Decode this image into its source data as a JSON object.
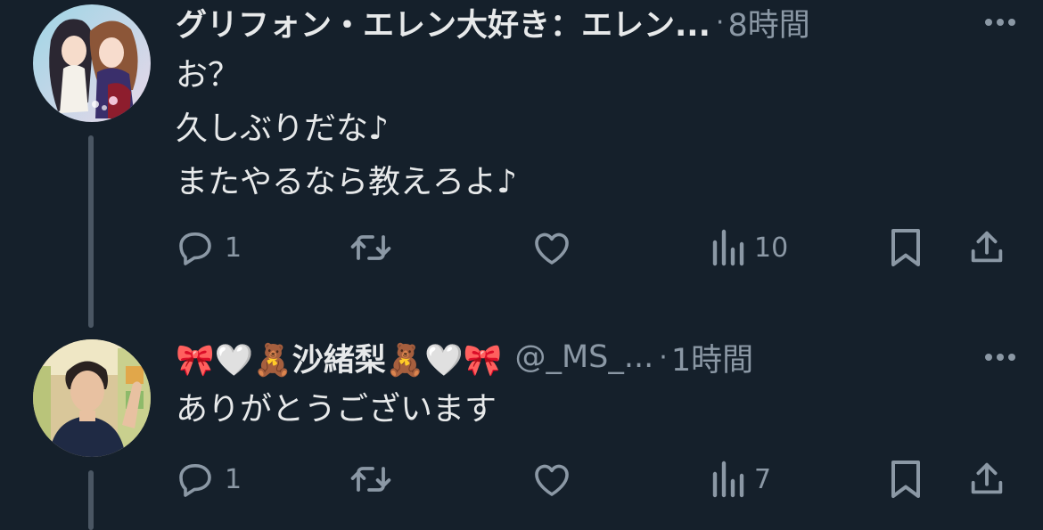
{
  "tweets": [
    {
      "display_name": "グリフォン・エレン大好き：エレン...",
      "handle": "",
      "separator": "·",
      "time": "8時間",
      "lines": [
        "お？",
        "久しぶりだな♪",
        "またやるなら教えろよ♪"
      ],
      "reply_count": "1",
      "retweet_count": "",
      "like_count": "",
      "views_count": "10",
      "avatar": "anime-illustration"
    },
    {
      "display_name": "🎀🤍🧸沙緒梨🧸🤍🎀",
      "handle": "@_MS_...",
      "separator": "·",
      "time": "1時間",
      "lines": [
        "ありがとうございます"
      ],
      "reply_count": "1",
      "retweet_count": "",
      "like_count": "",
      "views_count": "7",
      "avatar": "person-photo"
    }
  ],
  "icons": [
    "reply-icon",
    "retweet-icon",
    "like-icon",
    "views-icon",
    "bookmark-icon",
    "share-icon",
    "more-icon"
  ],
  "colors": {
    "background": "#15202b",
    "text": "#e7e9ea",
    "secondary": "#8b98a5",
    "thread_line": "#4a5663"
  }
}
